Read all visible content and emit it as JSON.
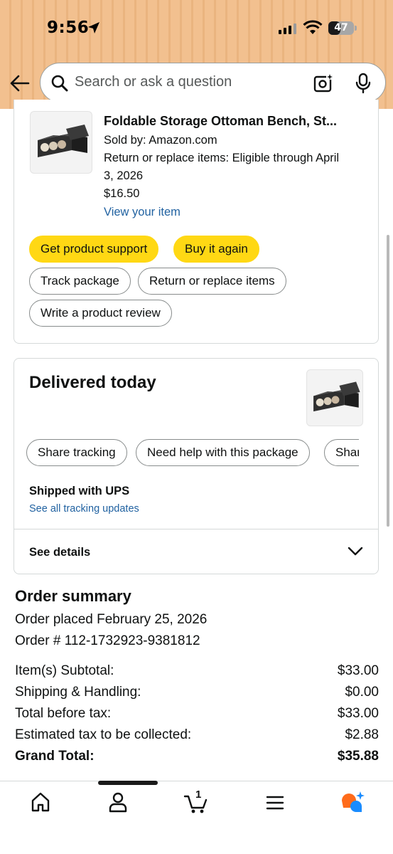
{
  "status_bar": {
    "time": "9:56",
    "battery": "47"
  },
  "search": {
    "placeholder": "Search or ask a question"
  },
  "item": {
    "title": "Foldable Storage Ottoman Bench, St...",
    "sold_by": "Sold by: Amazon.com",
    "return_line1": "Return or replace items: Eligible through April",
    "return_line2": "3, 2026",
    "price": "$16.50",
    "view_link": "View your item"
  },
  "actions": {
    "get_support": "Get product support",
    "buy_again": "Buy it again",
    "track_package": "Track package",
    "return_replace": "Return or replace items",
    "write_review": "Write a product review"
  },
  "delivery": {
    "heading": "Delivered today",
    "share_tracking": "Share tracking",
    "need_help": "Need help with this package",
    "share_partial": "Shar",
    "carrier": "Shipped with UPS",
    "tracking_link": "See all tracking updates",
    "see_details": "See details"
  },
  "order_summary": {
    "title": "Order summary",
    "placed": "Order placed February 25, 2026",
    "order_number": "Order # 112-1732923-9381812",
    "rows": [
      {
        "label": "Item(s) Subtotal:",
        "value": "$33.00"
      },
      {
        "label": "Shipping & Handling:",
        "value": "$0.00"
      },
      {
        "label": "Total before tax:",
        "value": "$33.00"
      },
      {
        "label": "Estimated tax to be collected:",
        "value": "$2.88"
      }
    ],
    "grand_total_label": "Grand Total:",
    "grand_total_value": "$35.88"
  },
  "nav": {
    "cart_count": "1"
  },
  "colors": {
    "header": "#f2c08f",
    "button_yellow": "#ffd814",
    "link": "#2162a1"
  },
  "icons": [
    "back-arrow-icon",
    "search-icon",
    "camera-icon",
    "mic-icon",
    "home-icon",
    "account-icon",
    "cart-icon",
    "menu-icon",
    "rufus-icon",
    "chevron-down-icon"
  ]
}
